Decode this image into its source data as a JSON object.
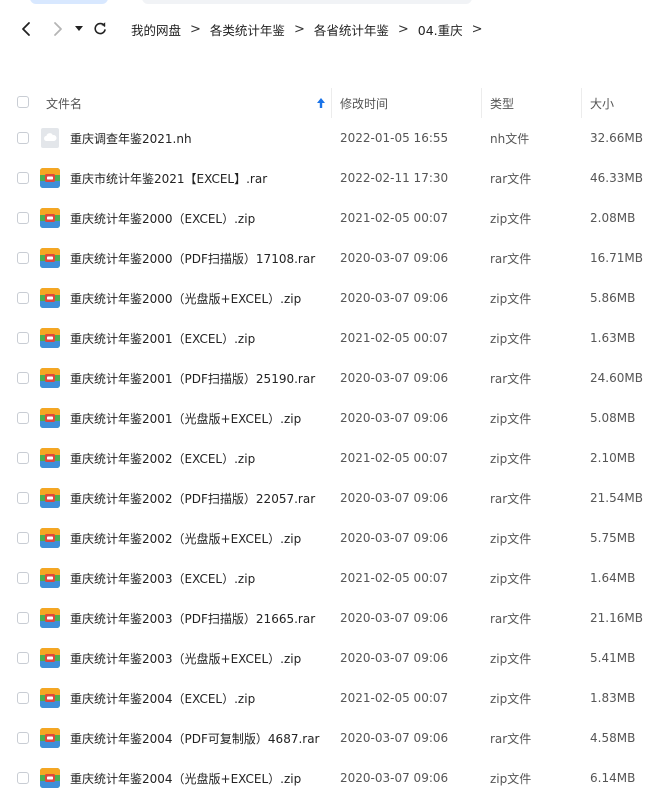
{
  "breadcrumb": [
    "我的网盘",
    "各类统计年鉴",
    "各省统计年鉴",
    "04.重庆"
  ],
  "columns": {
    "name": "文件名",
    "modified": "修改时间",
    "type": "类型",
    "size": "大小"
  },
  "colors": {
    "accent": "#1a73e8",
    "archive_icon_green": "#4caf50",
    "archive_icon_orange": "#f5a623",
    "archive_icon_red": "#e0473c"
  },
  "files": [
    {
      "name": "重庆调查年鉴2021.nh",
      "modified": "2022-01-05 16:55",
      "type": "nh文件",
      "size": "32.66MB",
      "icon": "cloud-file-icon"
    },
    {
      "name": "重庆市统计年鉴2021【EXCEL】.rar",
      "modified": "2022-02-11 17:30",
      "type": "rar文件",
      "size": "46.33MB",
      "icon": "archive-icon"
    },
    {
      "name": "重庆统计年鉴2000（EXCEL）.zip",
      "modified": "2021-02-05 00:07",
      "type": "zip文件",
      "size": "2.08MB",
      "icon": "archive-icon"
    },
    {
      "name": "重庆统计年鉴2000（PDF扫描版）17108.rar",
      "modified": "2020-03-07 09:06",
      "type": "rar文件",
      "size": "16.71MB",
      "icon": "archive-icon"
    },
    {
      "name": "重庆统计年鉴2000（光盘版+EXCEL）.zip",
      "modified": "2020-03-07 09:06",
      "type": "zip文件",
      "size": "5.86MB",
      "icon": "archive-icon"
    },
    {
      "name": "重庆统计年鉴2001（EXCEL）.zip",
      "modified": "2021-02-05 00:07",
      "type": "zip文件",
      "size": "1.63MB",
      "icon": "archive-icon"
    },
    {
      "name": "重庆统计年鉴2001（PDF扫描版）25190.rar",
      "modified": "2020-03-07 09:06",
      "type": "rar文件",
      "size": "24.60MB",
      "icon": "archive-icon"
    },
    {
      "name": "重庆统计年鉴2001（光盘版+EXCEL）.zip",
      "modified": "2020-03-07 09:06",
      "type": "zip文件",
      "size": "5.08MB",
      "icon": "archive-icon"
    },
    {
      "name": "重庆统计年鉴2002（EXCEL）.zip",
      "modified": "2021-02-05 00:07",
      "type": "zip文件",
      "size": "2.10MB",
      "icon": "archive-icon"
    },
    {
      "name": "重庆统计年鉴2002（PDF扫描版）22057.rar",
      "modified": "2020-03-07 09:06",
      "type": "rar文件",
      "size": "21.54MB",
      "icon": "archive-icon"
    },
    {
      "name": "重庆统计年鉴2002（光盘版+EXCEL）.zip",
      "modified": "2020-03-07 09:06",
      "type": "zip文件",
      "size": "5.75MB",
      "icon": "archive-icon"
    },
    {
      "name": "重庆统计年鉴2003（EXCEL）.zip",
      "modified": "2021-02-05 00:07",
      "type": "zip文件",
      "size": "1.64MB",
      "icon": "archive-icon"
    },
    {
      "name": "重庆统计年鉴2003（PDF扫描版）21665.rar",
      "modified": "2020-03-07 09:06",
      "type": "rar文件",
      "size": "21.16MB",
      "icon": "archive-icon"
    },
    {
      "name": "重庆统计年鉴2003（光盘版+EXCEL）.zip",
      "modified": "2020-03-07 09:06",
      "type": "zip文件",
      "size": "5.41MB",
      "icon": "archive-icon"
    },
    {
      "name": "重庆统计年鉴2004（EXCEL）.zip",
      "modified": "2021-02-05 00:07",
      "type": "zip文件",
      "size": "1.83MB",
      "icon": "archive-icon"
    },
    {
      "name": "重庆统计年鉴2004（PDF可复制版）4687.rar",
      "modified": "2020-03-07 09:06",
      "type": "rar文件",
      "size": "4.58MB",
      "icon": "archive-icon"
    },
    {
      "name": "重庆统计年鉴2004（光盘版+EXCEL）.zip",
      "modified": "2020-03-07 09:06",
      "type": "zip文件",
      "size": "6.14MB",
      "icon": "archive-icon"
    }
  ]
}
